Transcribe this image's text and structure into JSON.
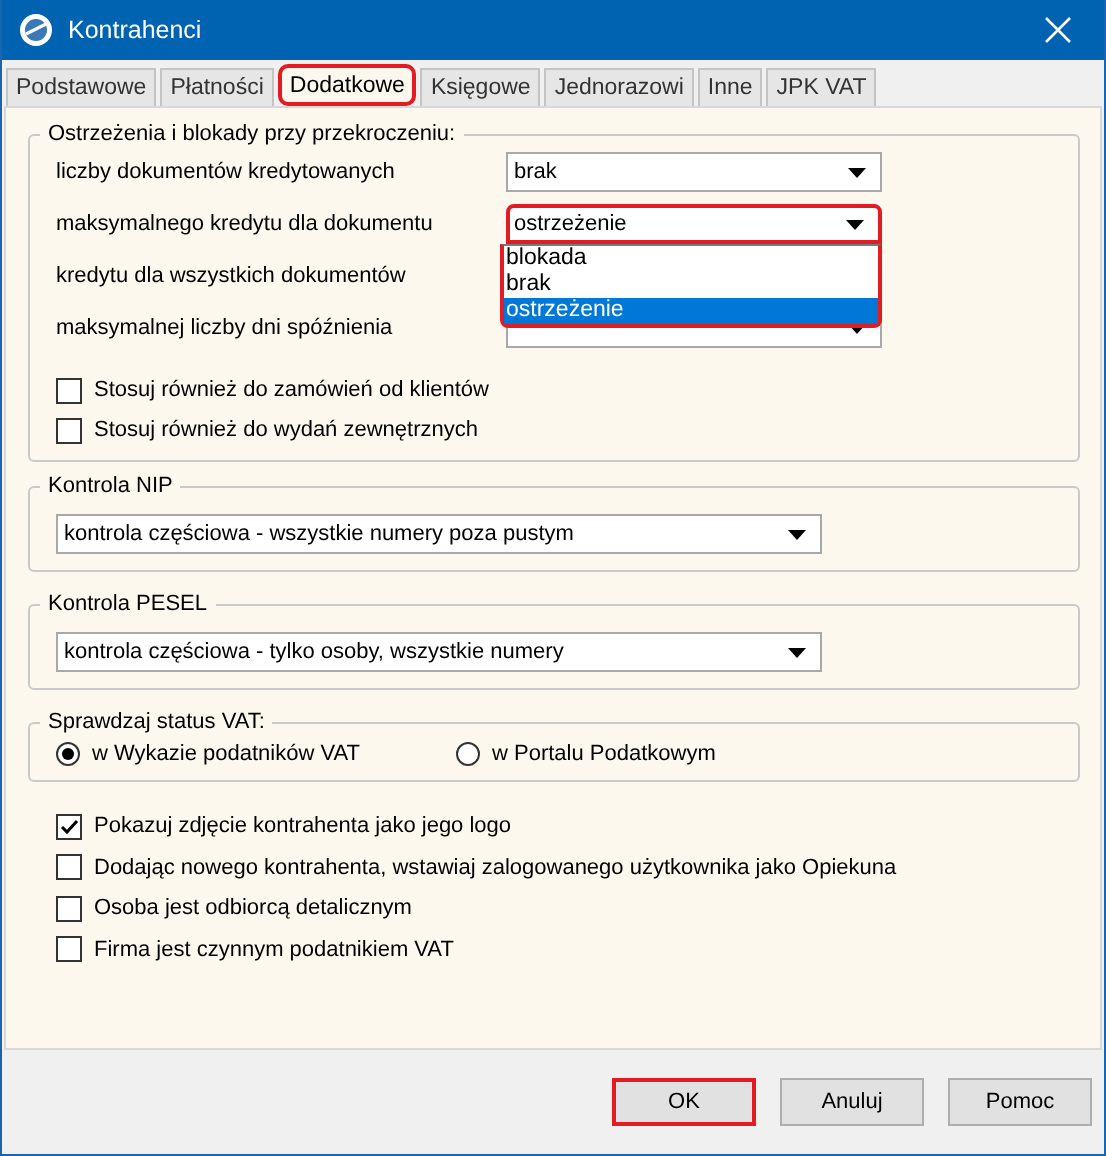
{
  "window": {
    "title": "Kontrahenci"
  },
  "tabs": [
    {
      "label": "Podstawowe",
      "selected": false,
      "highlighted": false
    },
    {
      "label": "Płatności",
      "selected": false,
      "highlighted": false
    },
    {
      "label": "Dodatkowe",
      "selected": true,
      "highlighted": true
    },
    {
      "label": "Księgowe",
      "selected": false,
      "highlighted": false
    },
    {
      "label": "Jednorazowi",
      "selected": false,
      "highlighted": false
    },
    {
      "label": "Inne",
      "selected": false,
      "highlighted": false
    },
    {
      "label": "JPK VAT",
      "selected": false,
      "highlighted": false
    }
  ],
  "limits": {
    "legend": "Ostrzeżenia i blokady przy przekroczeniu:",
    "rows": [
      {
        "label": "liczby dokumentów kredytowanych",
        "value": "brak",
        "open": false,
        "highlighted": false
      },
      {
        "label": "maksymalnego kredytu dla  dokumentu",
        "value": "ostrzeżenie",
        "open": true,
        "highlighted": true
      },
      {
        "label": "kredytu dla wszystkich dokumentów"
      },
      {
        "label": "maksymalnej liczby dni spóźnienia",
        "open": false,
        "highlighted": false
      }
    ],
    "dropdown_list": [
      {
        "label": "blokada",
        "selected": false
      },
      {
        "label": "brak",
        "selected": false
      },
      {
        "label": "ostrzeżenie",
        "selected": true
      }
    ],
    "options": [
      {
        "label": "Stosuj również do zamówień od klientów",
        "checked": false
      },
      {
        "label": "Stosuj również do wydań zewnętrznych",
        "checked": false
      }
    ]
  },
  "nip": {
    "legend": "Kontrola NIP",
    "value": "kontrola częściowa - wszystkie numery poza pustym"
  },
  "pesel": {
    "legend": "Kontrola PESEL",
    "value": "kontrola częściowa - tylko osoby, wszystkie numery"
  },
  "vat_status": {
    "legend": "Sprawdzaj status VAT:",
    "radios": [
      {
        "label": "w Wykazie podatników VAT",
        "selected": true
      },
      {
        "label": "w Portalu Podatkowym",
        "selected": false
      }
    ]
  },
  "options": [
    {
      "label": "Pokazuj zdjęcie kontrahenta jako jego logo",
      "checked": true
    },
    {
      "label": "Dodając nowego kontrahenta, wstawiaj zalogowanego użytkownika jako Opiekuna",
      "checked": false
    },
    {
      "label": "Osoba jest odbiorcą detalicznym",
      "checked": false
    },
    {
      "label": "Firma jest czynnym podatnikiem VAT",
      "checked": false
    }
  ],
  "buttons": [
    {
      "label": "OK",
      "highlighted": true
    },
    {
      "label": "Anuluj",
      "highlighted": false
    },
    {
      "label": "Pomoc",
      "highlighted": false
    }
  ]
}
